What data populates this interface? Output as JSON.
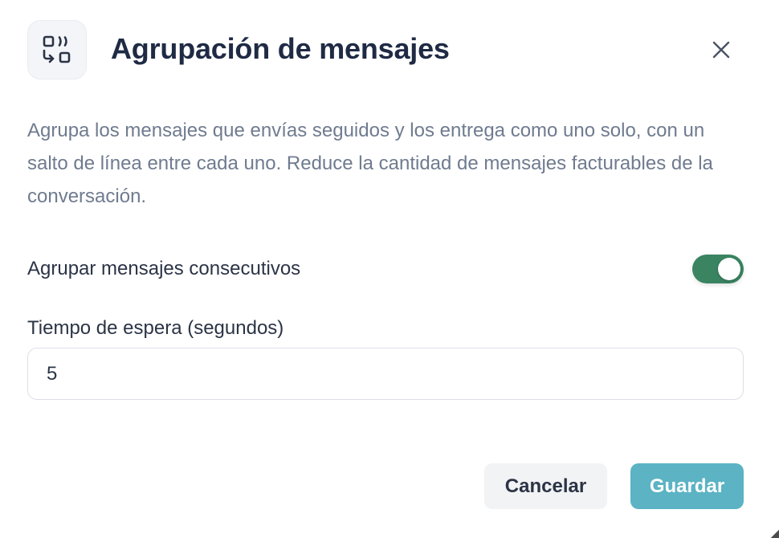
{
  "dialog": {
    "icon": "message-grouping-icon",
    "title": "Agrupación de mensajes",
    "close_icon": "close-icon",
    "description": "Agrupa los mensajes que envías seguidos y los entrega como uno solo, con un salto de línea entre cada uno. Reduce la cantidad de mensajes facturables de la conversación."
  },
  "settings": {
    "group_toggle": {
      "label": "Agrupar mensajes consecutivos",
      "enabled": true
    },
    "wait_time": {
      "label": "Tiempo de espera (segundos)",
      "value": "5"
    }
  },
  "actions": {
    "cancel_label": "Cancelar",
    "save_label": "Guardar"
  },
  "colors": {
    "title": "#1f2a44",
    "description": "#6f7b8f",
    "toggle_on": "#3a8462",
    "save_button": "#5bb3c4",
    "cancel_button": "#f2f3f5"
  }
}
